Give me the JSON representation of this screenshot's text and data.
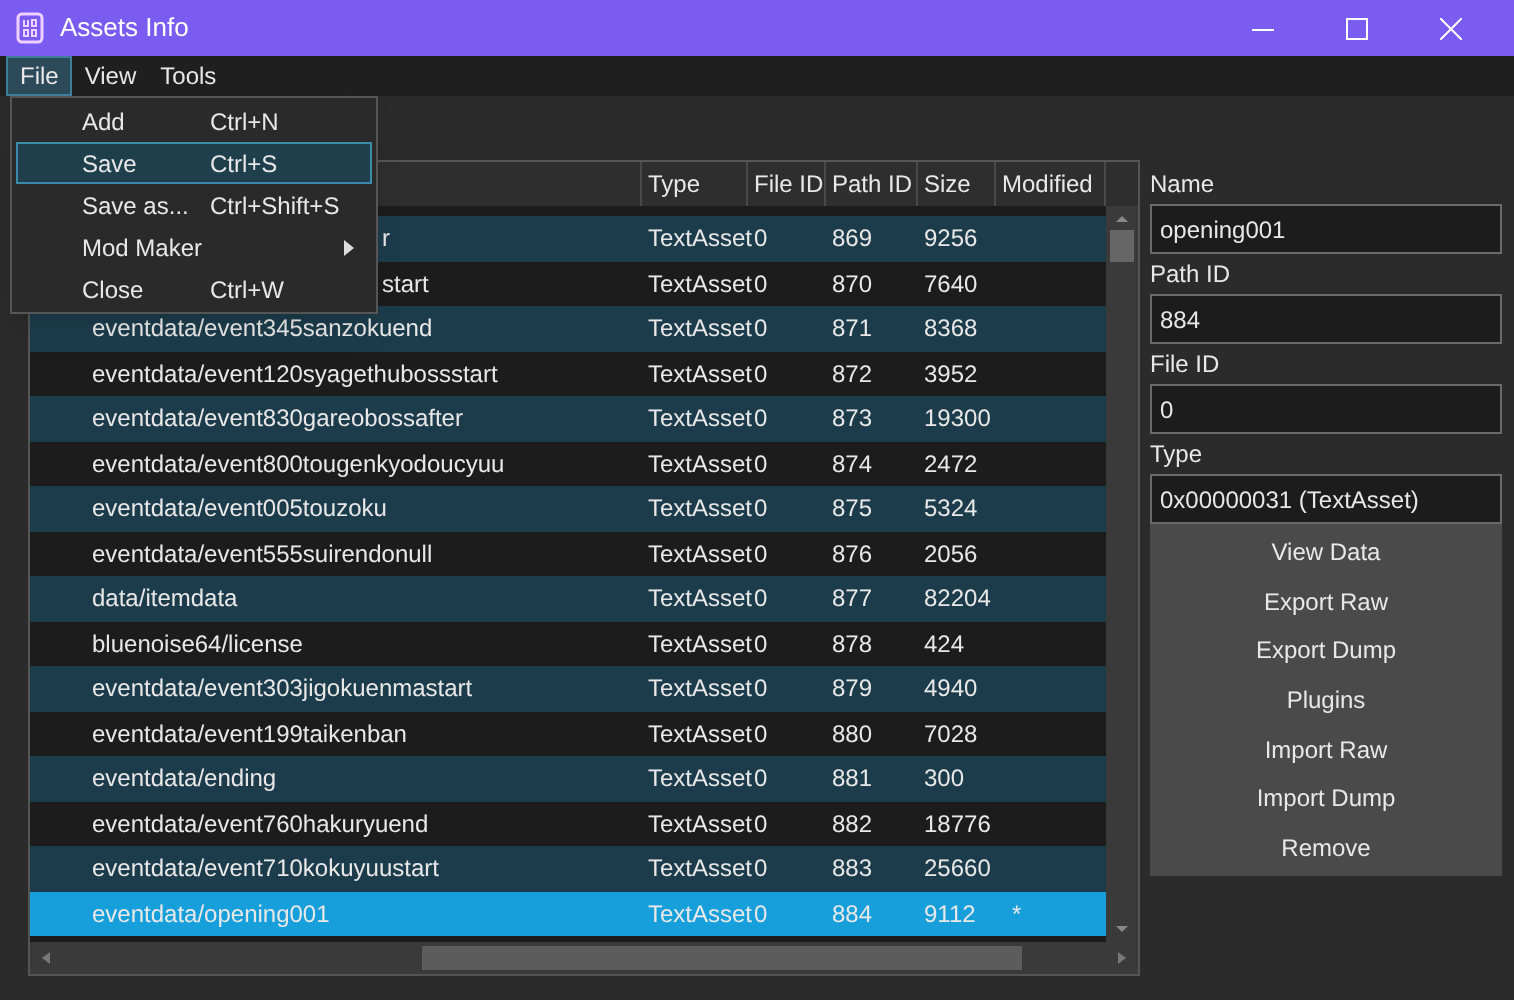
{
  "window": {
    "title": "Assets Info"
  },
  "menu_bar": [
    {
      "label": "File",
      "selected": true
    },
    {
      "label": "View",
      "selected": false
    },
    {
      "label": "Tools",
      "selected": false
    }
  ],
  "file_menu": [
    {
      "label": "Add",
      "shortcut": "Ctrl+N",
      "selected": false,
      "submenu": false
    },
    {
      "label": "Save",
      "shortcut": "Ctrl+S",
      "selected": true,
      "submenu": false
    },
    {
      "label": "Save as...",
      "shortcut": "Ctrl+Shift+S",
      "selected": false,
      "submenu": false
    },
    {
      "label": "Mod Maker",
      "selected": false,
      "submenu": true
    },
    {
      "label": "Close",
      "shortcut": "Ctrl+W",
      "selected": false,
      "submenu": false
    }
  ],
  "table": {
    "columns": [
      "Type",
      "File ID",
      "Path ID",
      "Size",
      "Modified"
    ],
    "rows": [
      {
        "name": "r",
        "covered": true,
        "type": "TextAsset",
        "file_id": "0",
        "path_id": "869",
        "size": "9256",
        "selected": false
      },
      {
        "name": "start",
        "covered": true,
        "type": "TextAsset",
        "file_id": "0",
        "path_id": "870",
        "size": "7640",
        "selected": false
      },
      {
        "name": "eventdata/event345sanzokuend",
        "covered": false,
        "type": "TextAsset",
        "file_id": "0",
        "path_id": "871",
        "size": "8368",
        "selected": false
      },
      {
        "name": "eventdata/event120syagethubossstart",
        "covered": false,
        "type": "TextAsset",
        "file_id": "0",
        "path_id": "872",
        "size": "3952",
        "selected": false
      },
      {
        "name": "eventdata/event830gareobossafter",
        "covered": false,
        "type": "TextAsset",
        "file_id": "0",
        "path_id": "873",
        "size": "19300",
        "selected": false
      },
      {
        "name": "eventdata/event800tougenkyodoucyuu",
        "covered": false,
        "type": "TextAsset",
        "file_id": "0",
        "path_id": "874",
        "size": "2472",
        "selected": false
      },
      {
        "name": "eventdata/event005touzoku",
        "covered": false,
        "type": "TextAsset",
        "file_id": "0",
        "path_id": "875",
        "size": "5324",
        "selected": false
      },
      {
        "name": "eventdata/event555suirendonull",
        "covered": false,
        "type": "TextAsset",
        "file_id": "0",
        "path_id": "876",
        "size": "2056",
        "selected": false
      },
      {
        "name": "data/itemdata",
        "covered": false,
        "type": "TextAsset",
        "file_id": "0",
        "path_id": "877",
        "size": "82204",
        "selected": false
      },
      {
        "name": "bluenoise64/license",
        "covered": false,
        "type": "TextAsset",
        "file_id": "0",
        "path_id": "878",
        "size": "424",
        "selected": false
      },
      {
        "name": "eventdata/event303jigokuenmastart",
        "covered": false,
        "type": "TextAsset",
        "file_id": "0",
        "path_id": "879",
        "size": "4940",
        "selected": false
      },
      {
        "name": "eventdata/event199taikenban",
        "covered": false,
        "type": "TextAsset",
        "file_id": "0",
        "path_id": "880",
        "size": "7028",
        "selected": false
      },
      {
        "name": "eventdata/ending",
        "covered": false,
        "type": "TextAsset",
        "file_id": "0",
        "path_id": "881",
        "size": "300",
        "selected": false
      },
      {
        "name": "eventdata/event760hakuryuend",
        "covered": false,
        "type": "TextAsset",
        "file_id": "0",
        "path_id": "882",
        "size": "18776",
        "selected": false
      },
      {
        "name": "eventdata/event710kokuyuustart",
        "covered": false,
        "type": "TextAsset",
        "file_id": "0",
        "path_id": "883",
        "size": "25660",
        "selected": false
      },
      {
        "name": "eventdata/opening001",
        "covered": false,
        "type": "TextAsset",
        "file_id": "0",
        "path_id": "884",
        "size": "9112",
        "modified": "*",
        "selected": true
      }
    ]
  },
  "details": [
    {
      "label": "Name",
      "value": "opening001"
    },
    {
      "label": "Path ID",
      "value": "884"
    },
    {
      "label": "File ID",
      "value": "0"
    },
    {
      "label": "Type",
      "value": "0x00000031 (TextAsset)"
    }
  ],
  "actions": [
    "View Data",
    "Export Raw",
    "Export Dump",
    "Plugins",
    "Import Raw",
    "Import Dump",
    "Remove"
  ]
}
